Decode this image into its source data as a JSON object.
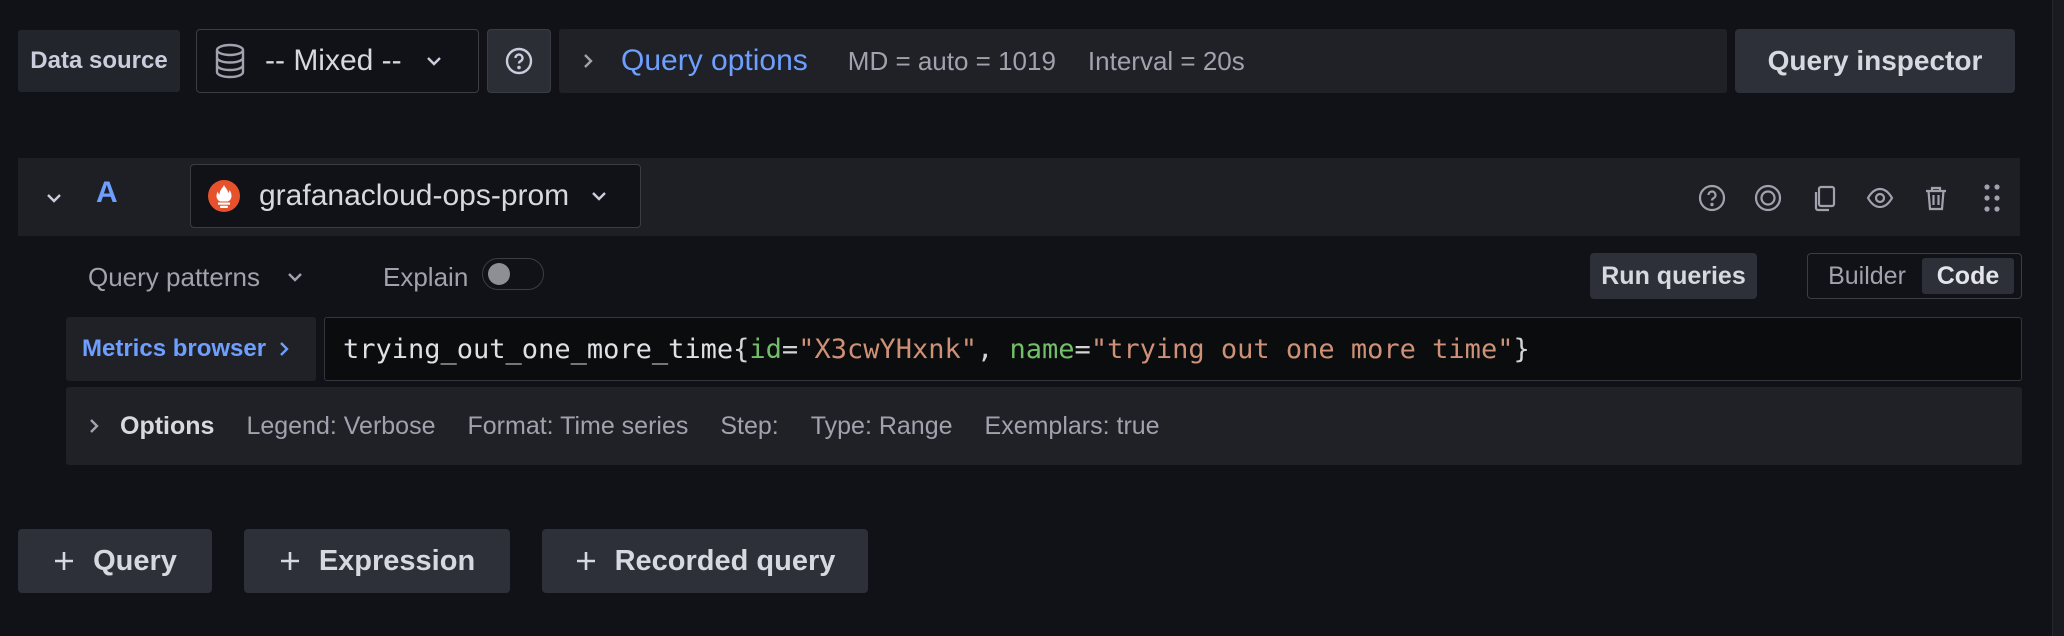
{
  "top_bar": {
    "data_source_label": "Data source",
    "data_source_value": "-- Mixed --",
    "query_options_title": "Query options",
    "query_options_md": "MD = auto = 1019",
    "query_options_interval": "Interval = 20s",
    "query_inspector_label": "Query inspector"
  },
  "query": {
    "ref_id": "A",
    "datasource": "grafanacloud-ops-prom",
    "query_patterns_label": "Query patterns",
    "explain_label": "Explain",
    "explain_on": false,
    "run_queries_label": "Run queries",
    "mode_builder": "Builder",
    "mode_code": "Code",
    "mode_selected": "Code",
    "metrics_browser_label": "Metrics browser",
    "expression": {
      "metric": "trying_out_one_more_time",
      "open_brace": "{",
      "label1_key": "id",
      "label1_op": "=",
      "label1_value": "\"X3cwYHxnk\"",
      "sep": ", ",
      "label2_key": "name",
      "label2_op": "=",
      "label2_value": "\"trying out one more time\"",
      "close_brace": "}"
    },
    "options": {
      "title": "Options",
      "legend": "Legend: Verbose",
      "format": "Format: Time series",
      "step": "Step:",
      "type": "Type: Range",
      "exemplars": "Exemplars: true"
    }
  },
  "add_buttons": {
    "query": "Query",
    "expression": "Expression",
    "recorded_query": "Recorded query"
  },
  "colors": {
    "background": "#111217",
    "accent_blue": "#6e9fff",
    "prometheus_orange": "#e6522c",
    "label_green": "#73bf69",
    "string_orange": "#ce9178"
  },
  "icons": {
    "data_source": "database-icon",
    "prometheus": "prometheus-icon",
    "row_actions": [
      "help-icon",
      "disable-query-icon",
      "duplicate-icon",
      "hide-response-icon",
      "delete-icon",
      "drag-handle-icon"
    ]
  }
}
